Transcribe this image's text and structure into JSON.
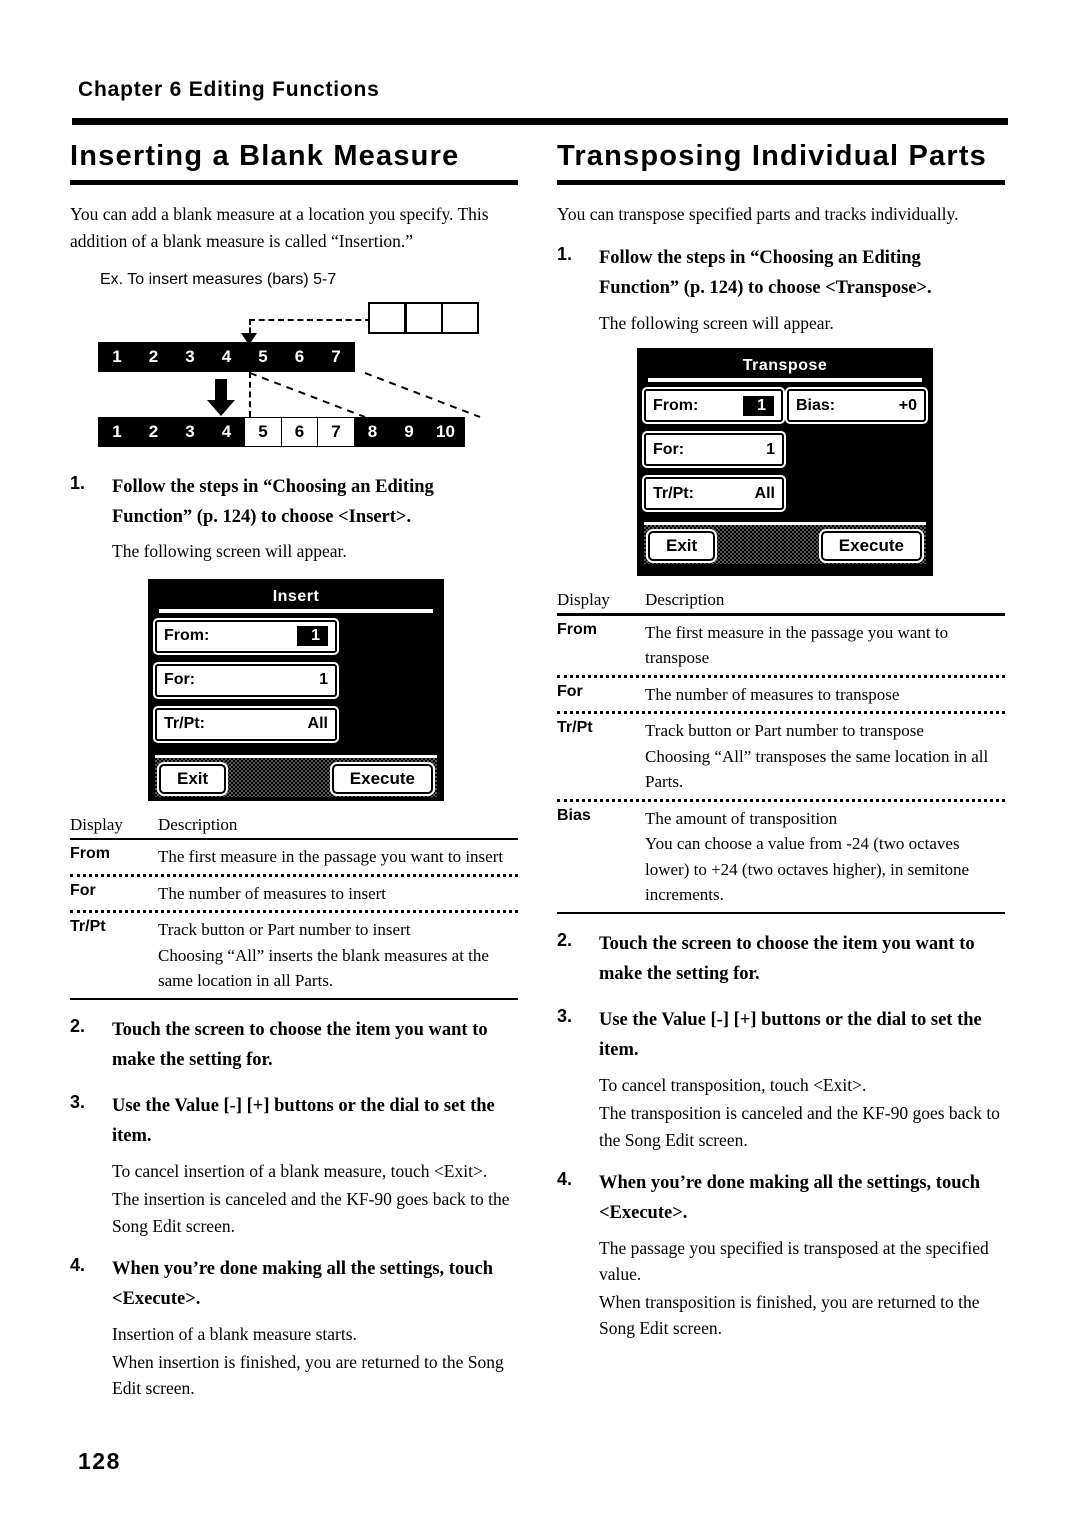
{
  "header": {
    "chapter": "Chapter 6 Editing Functions",
    "page_number": "128"
  },
  "left_column": {
    "title": "Inserting a Blank Measure",
    "intro": "You can add a blank measure at a location you specify. This addition of a blank measure is called “Insertion.”",
    "example_caption": "Ex. To insert measures (bars) 5-7",
    "diagram": {
      "inserted_blocks": [
        "",
        "",
        ""
      ],
      "before_row": [
        "1",
        "2",
        "3",
        "4",
        "5",
        "6",
        "7"
      ],
      "after_row": [
        "1",
        "2",
        "3",
        "4",
        "5",
        "6",
        "7",
        "8",
        "9",
        "10"
      ],
      "after_row_blank_indices": [
        4,
        5,
        6
      ]
    },
    "steps": [
      {
        "num": "1.",
        "text": "Follow the steps in “Choosing an Editing Function” (p. 124) to choose <Insert>.",
        "sub": [
          "The following screen will appear."
        ]
      },
      {
        "num": "2.",
        "text": "Touch the screen to choose the item you want to make the setting for.",
        "sub": []
      },
      {
        "num": "3.",
        "text": "Use the Value [-] [+] buttons or the dial to set the item.",
        "sub": [
          "To cancel insertion of a blank measure, touch <Exit>.",
          "The insertion is canceled and the KF-90 goes back to the Song Edit screen."
        ]
      },
      {
        "num": "4.",
        "text": "When you’re done making all the settings, touch <Execute>.",
        "sub": [
          "Insertion of a blank measure starts.",
          "When insertion is finished, you are returned to the Song Edit screen."
        ]
      }
    ],
    "lcd": {
      "title": "Insert",
      "fields": [
        {
          "label": "From:",
          "value": "1",
          "selected": true
        },
        {
          "label": "For:",
          "value": "1",
          "selected": false
        },
        {
          "label": "Tr/Pt:",
          "value": "All",
          "selected": false
        }
      ],
      "exit_label": "Exit",
      "execute_label": "Execute"
    },
    "table": {
      "head_display": "Display",
      "head_description": "Description",
      "rows": [
        {
          "display": "From",
          "description": "The first measure in the passage you want to insert"
        },
        {
          "display": "For",
          "description": "The number of measures to insert"
        },
        {
          "display": "Tr/Pt",
          "description": "Track button or Part number to insert\nChoosing “All” inserts the blank measures at the same location in all Parts."
        }
      ]
    }
  },
  "right_column": {
    "title": "Transposing Individual Parts",
    "intro": "You can transpose specified parts and tracks individually.",
    "steps": [
      {
        "num": "1.",
        "text": "Follow the steps in “Choosing an Editing Function” (p. 124) to choose <Transpose>.",
        "sub": [
          "The following screen will appear."
        ]
      },
      {
        "num": "2.",
        "text": "Touch the screen to choose the item you want to make the setting for.",
        "sub": []
      },
      {
        "num": "3.",
        "text": "Use the Value [-] [+] buttons or the dial to set the item.",
        "sub": [
          "To cancel transposition, touch <Exit>.",
          "The transposition is canceled and the KF-90 goes back to the Song Edit screen."
        ]
      },
      {
        "num": "4.",
        "text": "When you’re done making all the settings, touch <Execute>.",
        "sub": [
          "The passage you specified is transposed at the specified value.",
          "When transposition is finished, you are returned to the Song Edit screen."
        ]
      }
    ],
    "lcd": {
      "title": "Transpose",
      "fields": [
        {
          "label": "From:",
          "value": "1",
          "selected": true
        },
        {
          "label": "For:",
          "value": "1",
          "selected": false
        },
        {
          "label": "Tr/Pt:",
          "value": "All",
          "selected": false
        }
      ],
      "bias_field": {
        "label": "Bias:",
        "value": "+0",
        "selected": false
      },
      "exit_label": "Exit",
      "execute_label": "Execute"
    },
    "table": {
      "head_display": "Display",
      "head_description": "Description",
      "rows": [
        {
          "display": "From",
          "description": "The first measure in the passage you want to transpose"
        },
        {
          "display": "For",
          "description": "The number of measures to transpose"
        },
        {
          "display": "Tr/Pt",
          "description": "Track button or Part number to transpose\nChoosing “All” transposes the same location in all Parts."
        },
        {
          "display": "Bias",
          "description": "The amount of transposition\nYou can choose a value from -24 (two octaves lower) to +24 (two octaves higher), in semitone increments."
        }
      ]
    }
  }
}
